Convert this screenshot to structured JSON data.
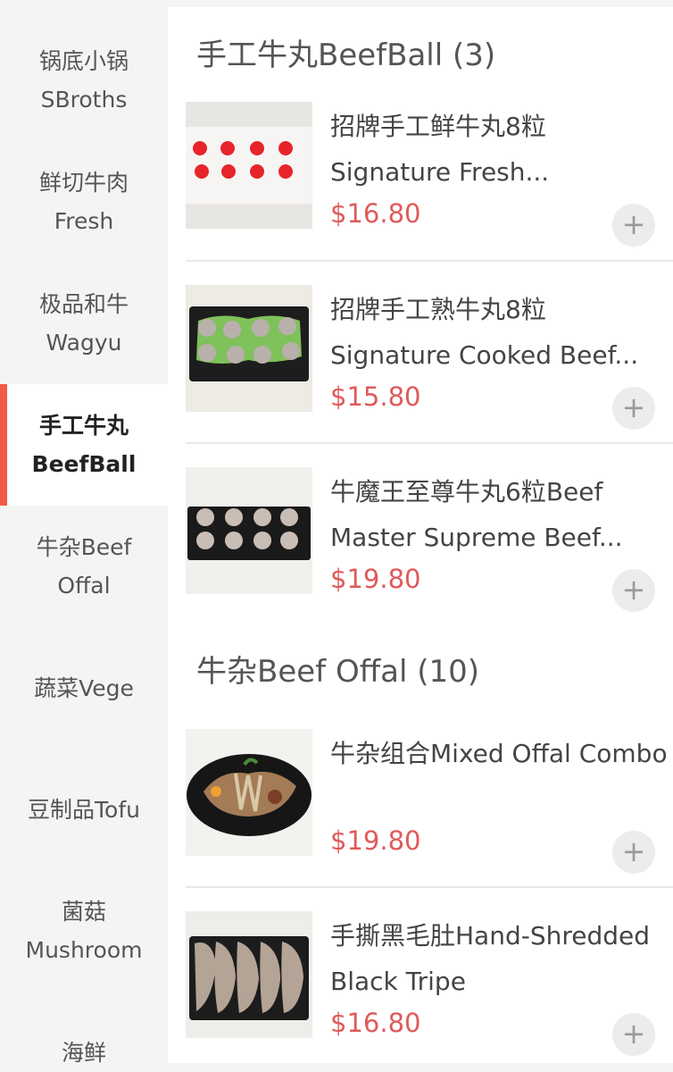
{
  "sidebar": {
    "items": [
      {
        "line1": "锅底小锅",
        "line2": "SBroths",
        "active": false
      },
      {
        "line1": "鲜切牛肉",
        "line2": "Fresh",
        "active": false
      },
      {
        "line1": "极品和牛",
        "line2": "Wagyu",
        "active": false
      },
      {
        "line1": "手工牛丸",
        "line2": "BeefBall",
        "active": true
      },
      {
        "line1": "牛杂Beef",
        "line2": "Offal",
        "active": false
      },
      {
        "line1": "蔬菜Vege",
        "line2": "",
        "active": false
      },
      {
        "line1": "豆制品Tofu",
        "line2": "",
        "active": false
      },
      {
        "line1": "菌菇",
        "line2": "Mushroom",
        "active": false
      },
      {
        "line1": "海鲜",
        "line2": "",
        "active": false
      }
    ]
  },
  "sections": [
    {
      "title": "手工牛丸BeefBall (3)",
      "dishes": [
        {
          "name": "招牌手工鲜牛丸8粒 Signature Fresh...",
          "price": "$16.80",
          "image": "red-beef-balls"
        },
        {
          "name": "招牌手工熟牛丸8粒 Signature Cooked Beef...",
          "price": "$15.80",
          "image": "cooked-beef-balls-lettuce"
        },
        {
          "name": "牛魔王至尊牛丸6粒Beef Master Supreme Beef...",
          "price": "$19.80",
          "image": "supreme-beef-balls"
        }
      ]
    },
    {
      "title": "牛杂Beef Offal (10)",
      "dishes": [
        {
          "name": "牛杂组合Mixed Offal Combo",
          "price": "$19.80",
          "image": "mixed-offal-plate"
        },
        {
          "name": "手撕黑毛肚Hand-Shredded Black Tripe",
          "price": "$16.80",
          "image": "black-tripe-tray"
        }
      ]
    }
  ],
  "icons": {
    "add": "plus-icon"
  },
  "colors": {
    "accent": "#f25a4a",
    "price": "#e05a5a",
    "sidebar_bg": "#f4f4f4"
  }
}
